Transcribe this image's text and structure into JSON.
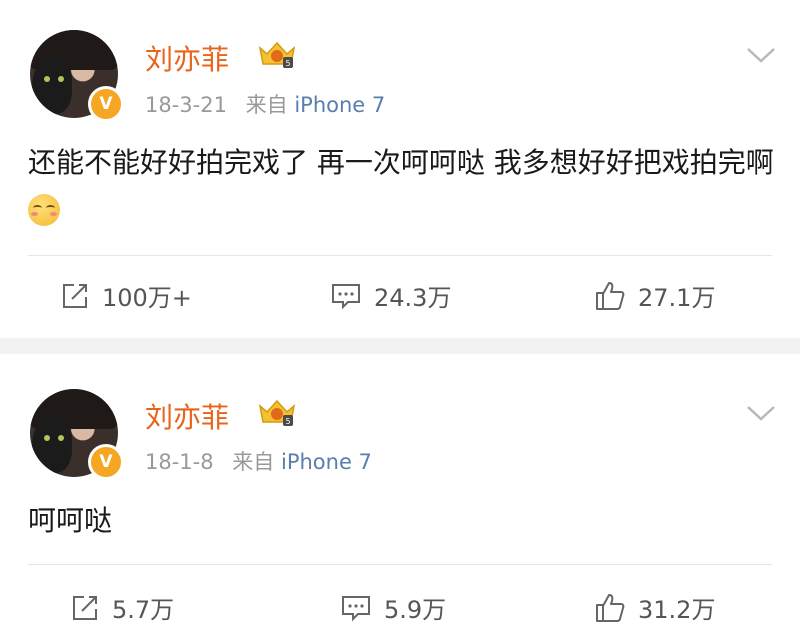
{
  "posts": [
    {
      "author": "刘亦菲",
      "date": "18-3-21",
      "source_prefix": "来自",
      "source_app": "iPhone 7",
      "text": "还能不能好好拍完戏了 再一次呵呵哒 我多想好好把戏拍完啊",
      "emoji": "sleepy-smile-emoji",
      "actions": {
        "repost": "100万+",
        "comment": "24.3万",
        "like": "27.1万"
      }
    },
    {
      "author": "刘亦菲",
      "date": "18-1-8",
      "source_prefix": "来自",
      "source_app": "iPhone 7",
      "text": "呵呵哒",
      "actions": {
        "repost": "5.7万",
        "comment": "5.9万",
        "like": "31.2万"
      }
    }
  ],
  "verified_badge": "V",
  "icons": [
    "repost-icon",
    "comment-icon",
    "like-icon",
    "chevron-down-icon",
    "crown-badge-icon"
  ],
  "colors": {
    "name": "#e8641b",
    "source_app": "#5b7dad",
    "badge": "#f5a623",
    "separator": "#f2f2f2"
  }
}
